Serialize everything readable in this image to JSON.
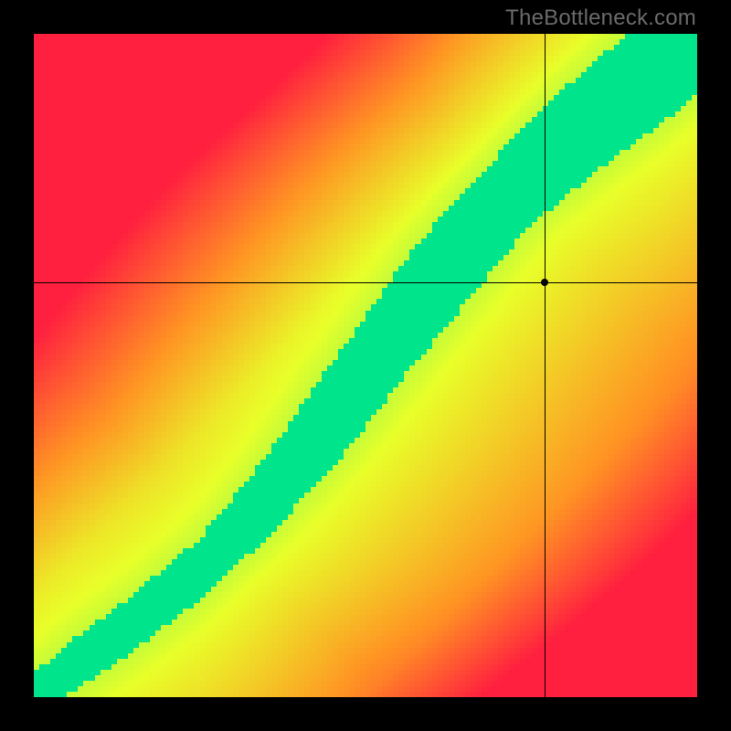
{
  "watermark": "TheBottleneck.com",
  "chart_data": {
    "type": "heatmap",
    "title": "",
    "xlabel": "",
    "ylabel": "",
    "xlim": [
      0,
      1
    ],
    "ylim": [
      0,
      1
    ],
    "grid": false,
    "legend": false,
    "marker": {
      "x": 0.77,
      "y": 0.625
    },
    "crosshair": {
      "x": 0.77,
      "y": 0.625
    },
    "optimal_band": {
      "description": "green S-curve band of ideal CPU↔GPU pairings; red = bottleneck; yellow = borderline",
      "center_curve": [
        [
          0.0,
          0.0
        ],
        [
          0.05,
          0.04
        ],
        [
          0.1,
          0.075
        ],
        [
          0.15,
          0.11
        ],
        [
          0.2,
          0.15
        ],
        [
          0.25,
          0.19
        ],
        [
          0.3,
          0.24
        ],
        [
          0.35,
          0.295
        ],
        [
          0.4,
          0.355
        ],
        [
          0.45,
          0.42
        ],
        [
          0.5,
          0.49
        ],
        [
          0.55,
          0.555
        ],
        [
          0.6,
          0.62
        ],
        [
          0.65,
          0.685
        ],
        [
          0.7,
          0.74
        ],
        [
          0.75,
          0.79
        ],
        [
          0.8,
          0.835
        ],
        [
          0.85,
          0.875
        ],
        [
          0.9,
          0.915
        ],
        [
          0.95,
          0.955
        ],
        [
          1.0,
          1.0
        ]
      ],
      "half_width": 0.065
    },
    "colormap": {
      "stops": [
        {
          "t": 0.0,
          "color": "#00e58b"
        },
        {
          "t": 0.33,
          "color": "#e8ff29"
        },
        {
          "t": 0.66,
          "color": "#ff9423"
        },
        {
          "t": 1.0,
          "color": "#ff1f3f"
        }
      ]
    },
    "pixelation": 120
  }
}
